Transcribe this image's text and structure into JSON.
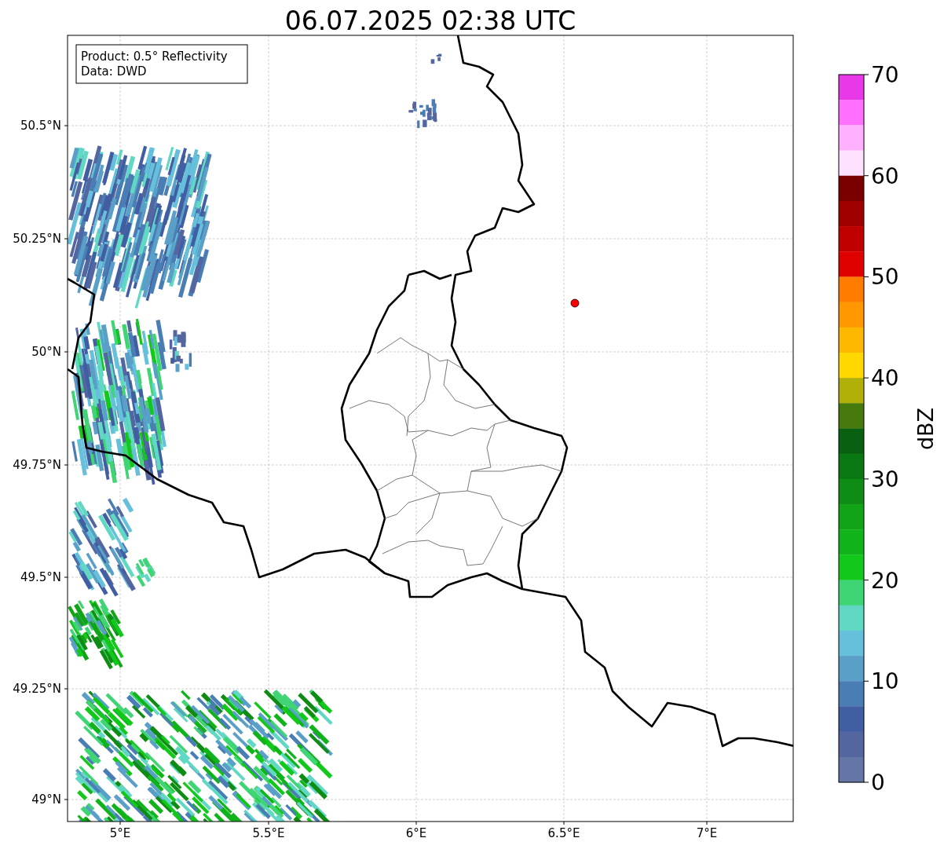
{
  "title": "06.07.2025 02:38 UTC",
  "info_box": [
    "Product: 0.5° Reflectivity",
    "Data: DWD"
  ],
  "map": {
    "lat_ticks": [
      "50.5°N",
      "50.25°N",
      "50°N",
      "49.75°N",
      "49.5°N",
      "49.25°N",
      "49°N"
    ],
    "lon_ticks": [
      "5°E",
      "5.5°E",
      "6°E",
      "6.5°E",
      "7°E"
    ]
  },
  "colorbar": {
    "label": "dBZ",
    "ticks": [
      "70",
      "60",
      "50",
      "40",
      "30",
      "20",
      "10",
      "0"
    ],
    "bands": [
      {
        "color": "#e838e8"
      },
      {
        "color": "#ff70ff"
      },
      {
        "color": "#ffb0ff"
      },
      {
        "color": "#ffe0ff"
      },
      {
        "color": "#780000"
      },
      {
        "color": "#a00000"
      },
      {
        "color": "#c00000"
      },
      {
        "color": "#e00000"
      },
      {
        "color": "#ff7c00"
      },
      {
        "color": "#ff9800"
      },
      {
        "color": "#ffb800"
      },
      {
        "color": "#ffd800"
      },
      {
        "color": "#b0b008"
      },
      {
        "color": "#467a0c"
      },
      {
        "color": "#086010"
      },
      {
        "color": "#0a7812"
      },
      {
        "color": "#0e8c14"
      },
      {
        "color": "#10a416"
      },
      {
        "color": "#10b41a"
      },
      {
        "color": "#12c81a"
      },
      {
        "color": "#3fd474"
      },
      {
        "color": "#60d8c4"
      },
      {
        "color": "#66c0dc"
      },
      {
        "color": "#5a9fc8"
      },
      {
        "color": "#4a7db4"
      },
      {
        "color": "#425ea2"
      },
      {
        "color": "#5466a0"
      },
      {
        "color": "#6476a6"
      }
    ]
  }
}
